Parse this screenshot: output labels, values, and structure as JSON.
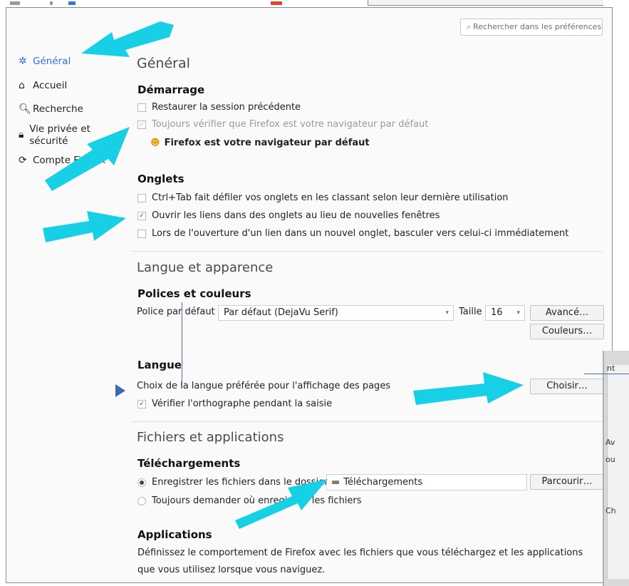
{
  "search": {
    "placeholder": "Rechercher dans les préférences"
  },
  "sidebar": {
    "items": [
      {
        "label": "Général",
        "icon": "gear-icon"
      },
      {
        "label": "Accueil",
        "icon": "home-icon"
      },
      {
        "label": "Recherche",
        "icon": "search-icon"
      },
      {
        "label": "Vie privée et sécurité",
        "icon": "lock-icon"
      },
      {
        "label": "Compte Firefox",
        "icon": "sync-icon"
      }
    ]
  },
  "main": {
    "title": "Général",
    "startup": {
      "heading": "Démarrage",
      "restore_session": "Restaurer la session précédente",
      "check_default": "Toujours vérifier que Firefox est votre navigateur par défaut",
      "default_status": "Firefox est votre navigateur par défaut"
    },
    "tabs": {
      "heading": "Onglets",
      "ctrl_tab": "Ctrl+Tab fait défiler vos onglets en les classant selon leur dernière utilisation",
      "open_links": "Ouvrir les liens dans des onglets au lieu de nouvelles fenêtres",
      "switch_tab": "Lors de l'ouverture d'un lien dans un nouvel onglet, basculer vers celui-ci immédiatement"
    },
    "language_appearance": {
      "title": "Langue et apparence",
      "fonts_heading": "Polices et couleurs",
      "font_label": "Police par défaut",
      "font_value": "Par défaut (DejaVu Serif)",
      "size_label": "Taille",
      "size_value": "16",
      "advanced_button": "Avancé…",
      "colors_button": "Couleurs…"
    },
    "language": {
      "heading": "Langue",
      "choice_text": "Choix de la langue préférée pour l'affichage des pages",
      "choose_button": "Choisir…",
      "spellcheck": "Vérifier l'orthographe pendant la saisie"
    },
    "files_apps": {
      "title": "Fichiers et applications",
      "downloads_heading": "Téléchargements",
      "save_files": "Enregistrer les fichiers dans le dossier",
      "folder_value": "Téléchargements",
      "browse_button": "Parcourir…",
      "always_ask": "Toujours demander où enregistrer les fichiers",
      "applications_heading": "Applications",
      "applications_desc": "Définissez le comportement de Firefox avec les fichiers que vous téléchargez et les applications que vous utilisez lorsque vous naviguez."
    }
  },
  "popup": {
    "frag1": "nt",
    "frag2": "Av",
    "frag3": "ou",
    "frag4": "Ch"
  },
  "colors": {
    "accent": "#2b74d6",
    "arrow": "#17d0e6"
  }
}
